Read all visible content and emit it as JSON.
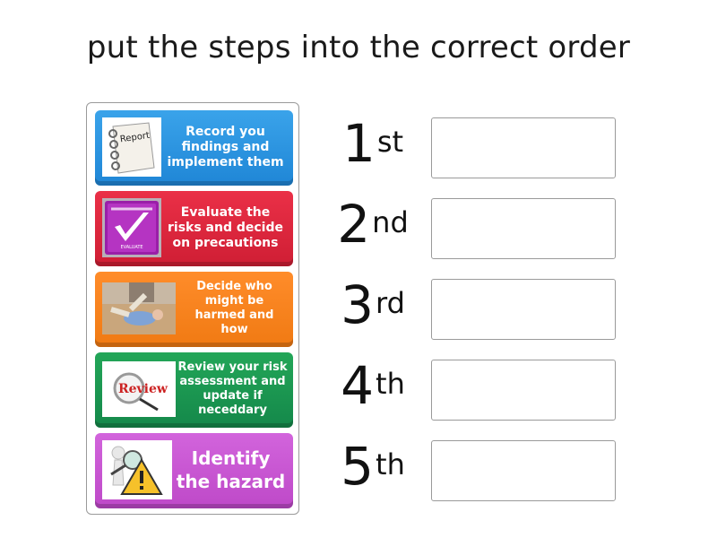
{
  "title": "put the steps into the correct order",
  "cards": [
    {
      "text": "Record you findings and implement them",
      "lines": [
        "Record",
        "you findings and",
        "implement them"
      ],
      "image": "report-notebook-icon",
      "color": "#2b93e0"
    },
    {
      "text": "Evaluate the risks and decide on precautions",
      "lines": [
        "Evaluate the",
        "risks and decide",
        "on precautions"
      ],
      "image": "evaluate-checkmark-icon",
      "image_label": "EVALUATE",
      "color": "#dd263d"
    },
    {
      "text": "Decide who might be harmed and how",
      "lines": [
        "Decide",
        "who might",
        "be harmed",
        "and how"
      ],
      "image": "fallen-person-photo",
      "color": "#f7831e"
    },
    {
      "text": "Review your risk assessment and update if neceddary",
      "lines": [
        "Review your",
        "risk assessment",
        "and update",
        "if neceddary"
      ],
      "image": "review-magnifier-icon",
      "image_label": "Review",
      "color": "#1b9750"
    },
    {
      "text": "Identify the hazard",
      "lines": [
        "Identify",
        "the hazard"
      ],
      "image": "hazard-warning-icon",
      "color": "#c955d2"
    }
  ],
  "slots": [
    {
      "num": "1",
      "suffix": "st",
      "value": ""
    },
    {
      "num": "2",
      "suffix": "nd",
      "value": ""
    },
    {
      "num": "3",
      "suffix": "rd",
      "value": ""
    },
    {
      "num": "4",
      "suffix": "th",
      "value": ""
    },
    {
      "num": "5",
      "suffix": "th",
      "value": ""
    }
  ]
}
